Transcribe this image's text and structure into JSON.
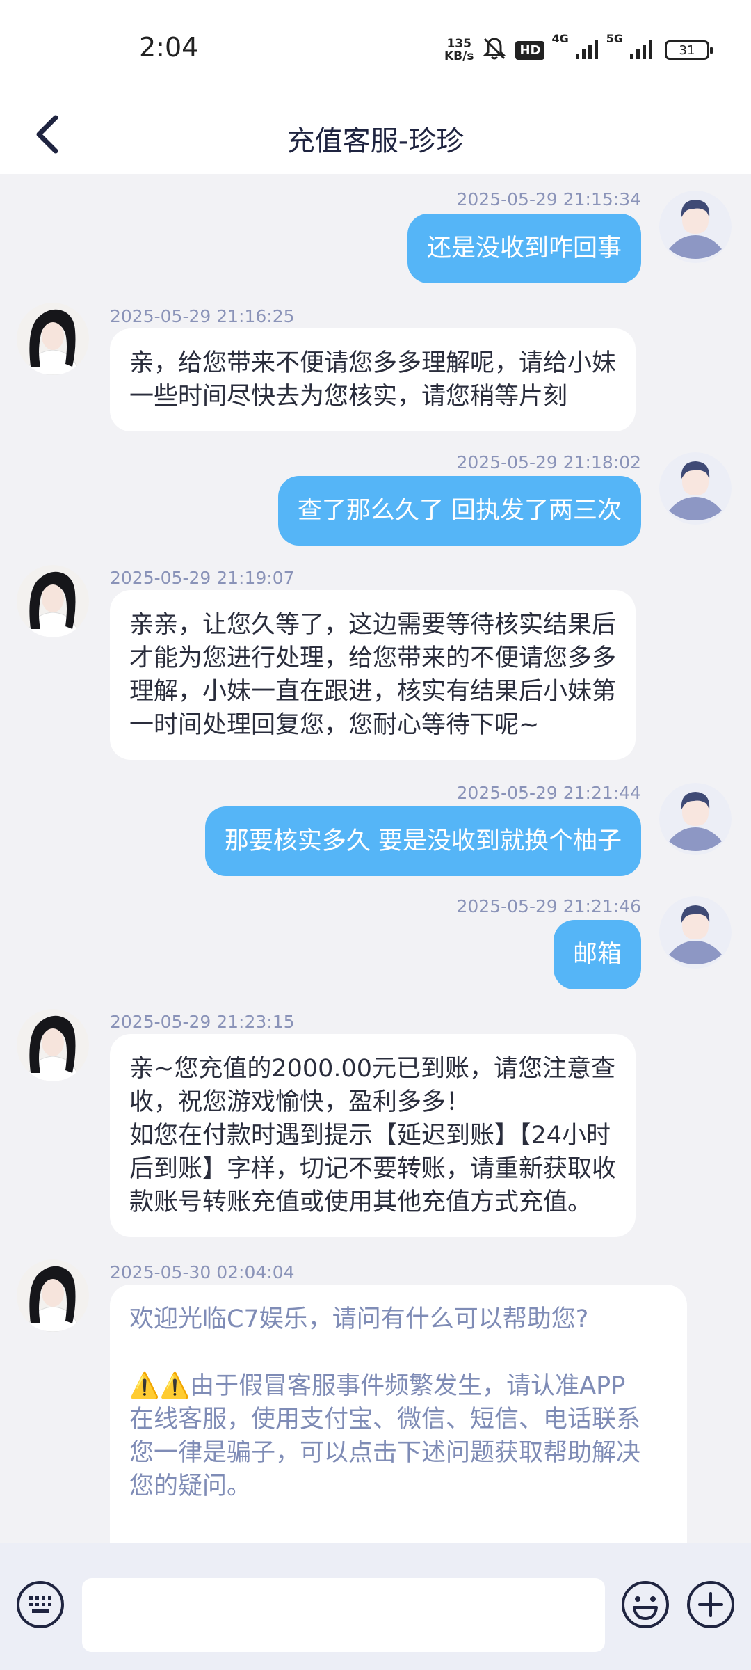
{
  "status_bar": {
    "time": "2:04",
    "net_speed_value": "135",
    "net_speed_unit": "KB/s",
    "hd_label": "HD",
    "network_4g": "4G",
    "network_5g": "5G",
    "battery": "31"
  },
  "header": {
    "title": "充值客服-珍珍"
  },
  "messages": [
    {
      "side": "out",
      "time": "2025-05-29 21:15:34",
      "lines": [
        "还是没收到咋回事"
      ]
    },
    {
      "side": "in",
      "time": "2025-05-29 21:16:25",
      "lines": [
        "亲，给您带来不便请您多多理解呢，请给小妹",
        "一些时间尽快去为您核实，请您稍等片刻"
      ]
    },
    {
      "side": "out",
      "time": "2025-05-29 21:18:02",
      "lines": [
        "查了那么久了 回执发了两三次"
      ]
    },
    {
      "side": "in",
      "time": "2025-05-29 21:19:07",
      "lines": [
        "亲亲，让您久等了，这边需要等待核实结果后",
        "才能为您进行处理，给您带来的不便请您多多",
        "理解，小妹一直在跟进，核实有结果后小妹第",
        "一时间处理回复您，您耐心等待下呢~"
      ]
    },
    {
      "side": "out",
      "time": "2025-05-29 21:21:44",
      "lines": [
        "那要核实多久 要是没收到就换个柚子"
      ]
    },
    {
      "side": "out",
      "time": "2025-05-29 21:21:46",
      "lines": [
        "邮箱"
      ]
    },
    {
      "side": "in",
      "time": "2025-05-29 21:23:15",
      "lines": [
        "亲~您充值的2000.00元已到账，请您注意查",
        "收，祝您游戏愉快，盈利多多！",
        "如您在付款时遇到提示【延迟到账】【24小时",
        "后到账】字样，切记不要转账，请重新获取收",
        "款账号转账充值或使用其他充值方式充值。"
      ]
    },
    {
      "side": "in",
      "time": "2025-05-30 02:04:04",
      "lines": [
        "欢迎光临C7娱乐，请问有什么可以帮助您?",
        "",
        "⚠️⚠️由于假冒客服事件频繁发生，请认准APP",
        "在线客服，使用支付宝、微信、短信、电话联系",
        "您一律是骗子，可以点击下述问题获取帮助解决",
        "您的疑问。",
        ""
      ]
    }
  ],
  "input": {
    "placeholder": ""
  },
  "colors": {
    "outgoing_bubble": "#55b5f7",
    "incoming_bubble": "#ffffff",
    "timestamp": "#8a93b8",
    "system_text": "#7f8cb6",
    "chat_background": "#f2f2f5",
    "icon_navy": "#1f2440"
  }
}
